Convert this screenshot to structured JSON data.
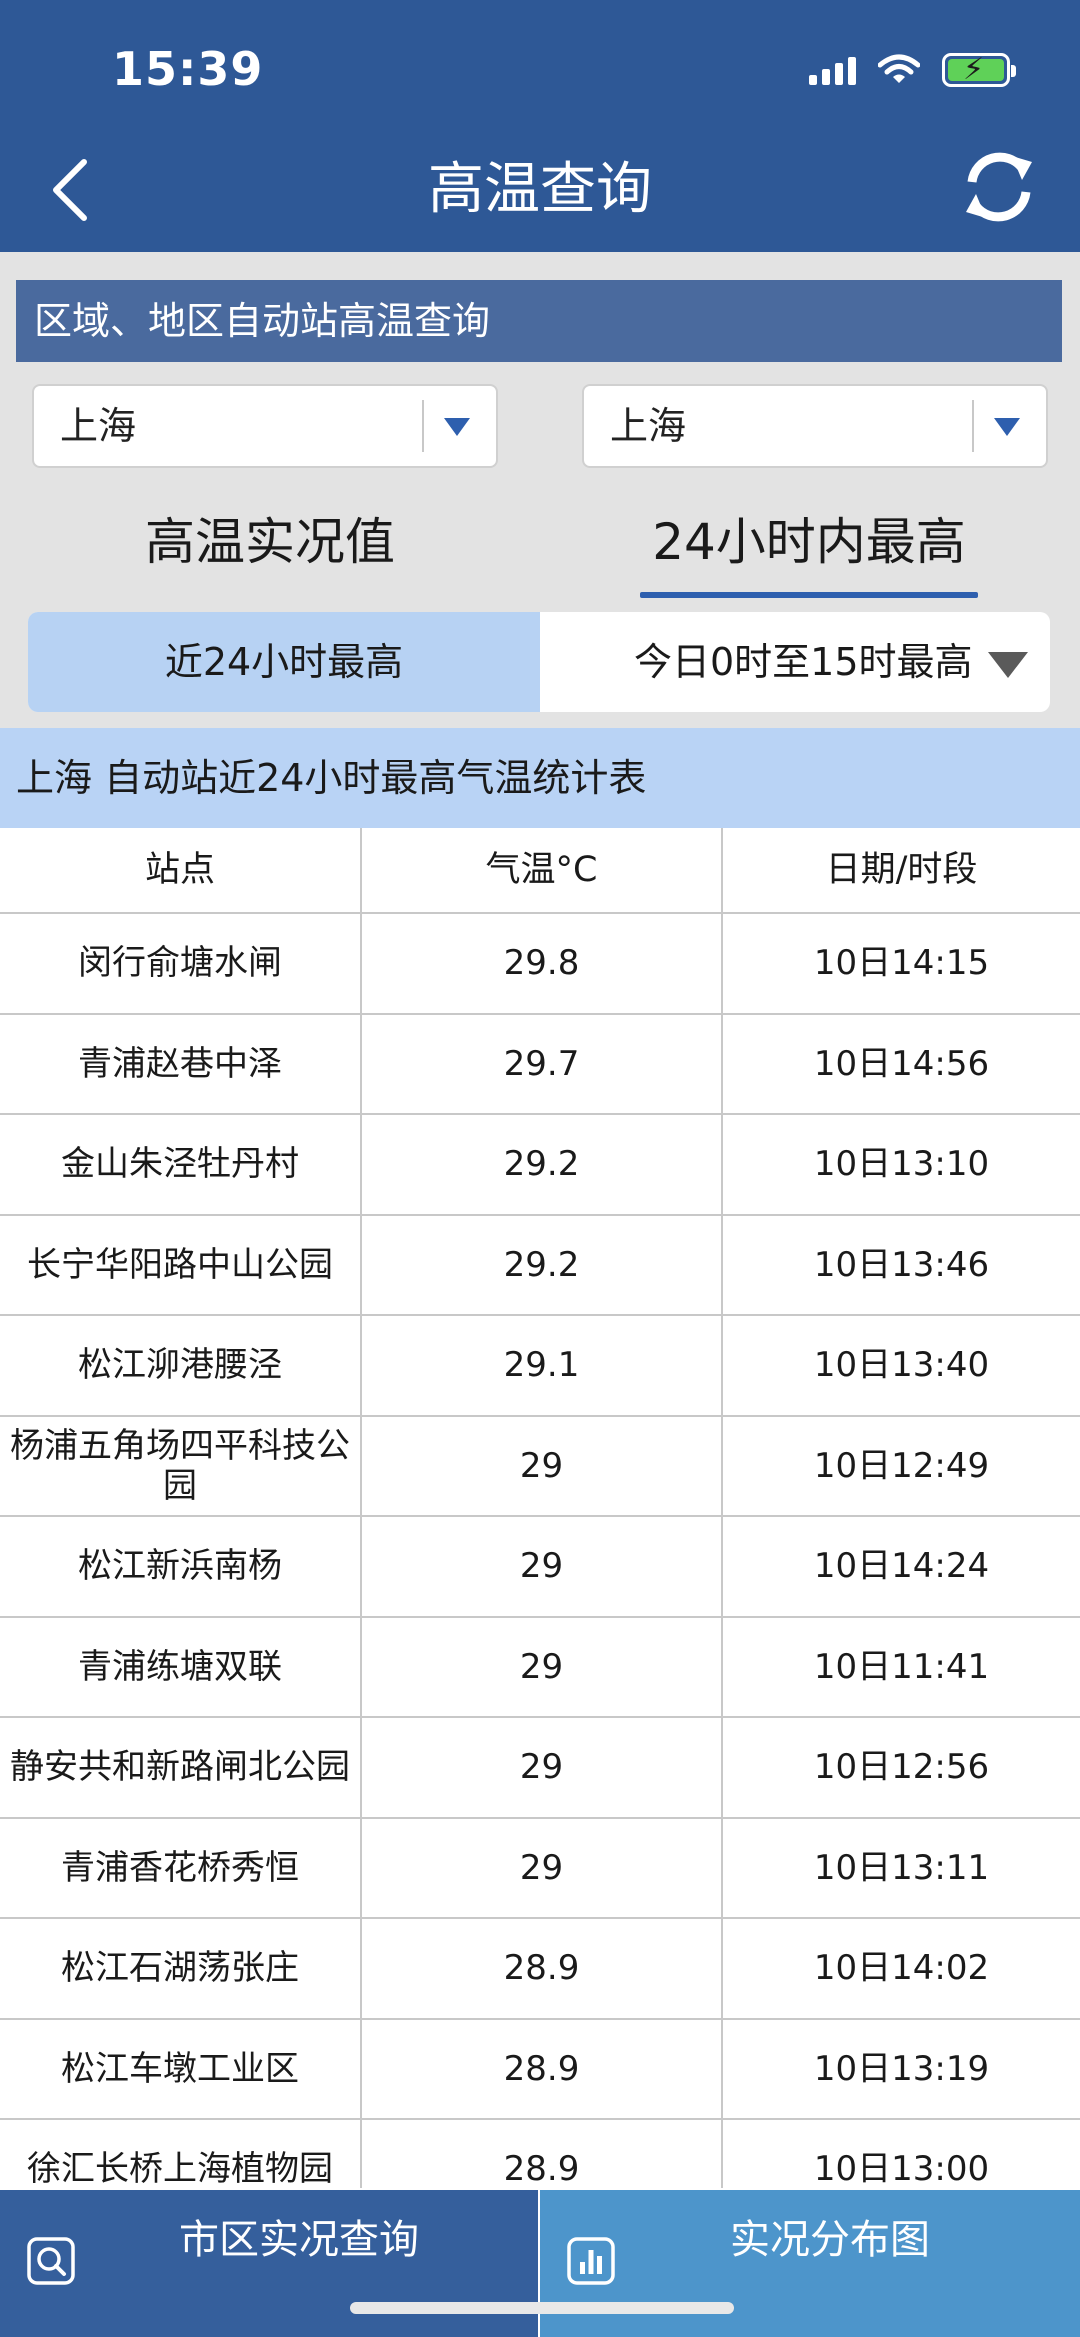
{
  "status_bar": {
    "time": "15:39"
  },
  "header": {
    "title": "高温查询"
  },
  "section_title": "区域、地区自动站高温查询",
  "selects": {
    "left": "上海",
    "right": "上海"
  },
  "tabs": {
    "realtime": "高温实况值",
    "max24": "24小时内最高",
    "active": "max24"
  },
  "segment": {
    "left": "近24小时最高",
    "right": "今日0时至15时最高"
  },
  "table": {
    "title": "上海 自动站近24小时最高气温统计表",
    "headers": [
      "站点",
      "气温°C",
      "日期/时段"
    ],
    "rows": [
      [
        "闵行俞塘水闸",
        "29.8",
        "10日14:15"
      ],
      [
        "青浦赵巷中泽",
        "29.7",
        "10日14:56"
      ],
      [
        "金山朱泾牡丹村",
        "29.2",
        "10日13:10"
      ],
      [
        "长宁华阳路中山公园",
        "29.2",
        "10日13:46"
      ],
      [
        "松江泖港腰泾",
        "29.1",
        "10日13:40"
      ],
      [
        "杨浦五角场四平科技公园",
        "29",
        "10日12:49"
      ],
      [
        "松江新浜南杨",
        "29",
        "10日14:24"
      ],
      [
        "青浦练塘双联",
        "29",
        "10日11:41"
      ],
      [
        "静安共和新路闸北公园",
        "29",
        "10日12:56"
      ],
      [
        "青浦香花桥秀恒",
        "29",
        "10日13:11"
      ],
      [
        "松江石湖荡张庄",
        "28.9",
        "10日14:02"
      ],
      [
        "松江车墩工业区",
        "28.9",
        "10日13:19"
      ],
      [
        "徐汇长桥上海植物园",
        "28.9",
        "10日13:00"
      ]
    ]
  },
  "bottom_nav": {
    "left": "市区实况查询",
    "right": "实况分布图"
  },
  "colors": {
    "header": "#2e5896",
    "accent": "#2e5fae",
    "highlight": "#b9d3f5"
  }
}
